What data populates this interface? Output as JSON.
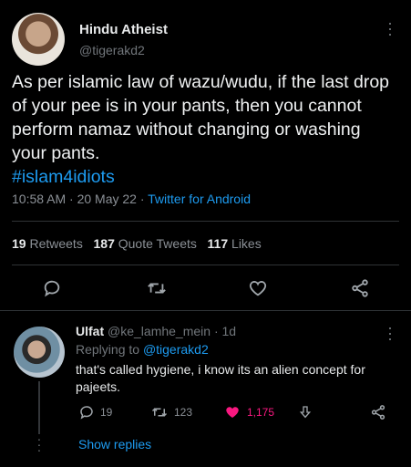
{
  "tweet": {
    "author_name": "Hindu Atheist",
    "handle": "@tigerakd2",
    "text": "As per islamic law of wazu/wudu, if the last drop of your pee is in your pants, then you cannot perform namaz without changing or washing your pants.",
    "hashtag": "#islam4idiots",
    "time": "10:58 AM · 20 May 22 · ",
    "source": "Twitter for Android",
    "retweets_count": "19",
    "retweets_label": " Retweets",
    "quote_count": "187",
    "quote_label": " Quote Tweets",
    "likes_count": "117",
    "likes_label": " Likes"
  },
  "reply": {
    "author_name": "Ulfat",
    "handle_time": " @ke_lamhe_mein · 1d",
    "replying_label": "Replying to ",
    "replying_to": "@tigerakd2",
    "text": "that's called hygiene, i know its an alien concept for pajeets.",
    "reply_count": "19",
    "retweet_count": "123",
    "like_count": "1,175",
    "show_replies": "Show replies"
  },
  "colors": {
    "accent": "#1d9bf0",
    "like": "#f91880",
    "background": "#000000"
  }
}
